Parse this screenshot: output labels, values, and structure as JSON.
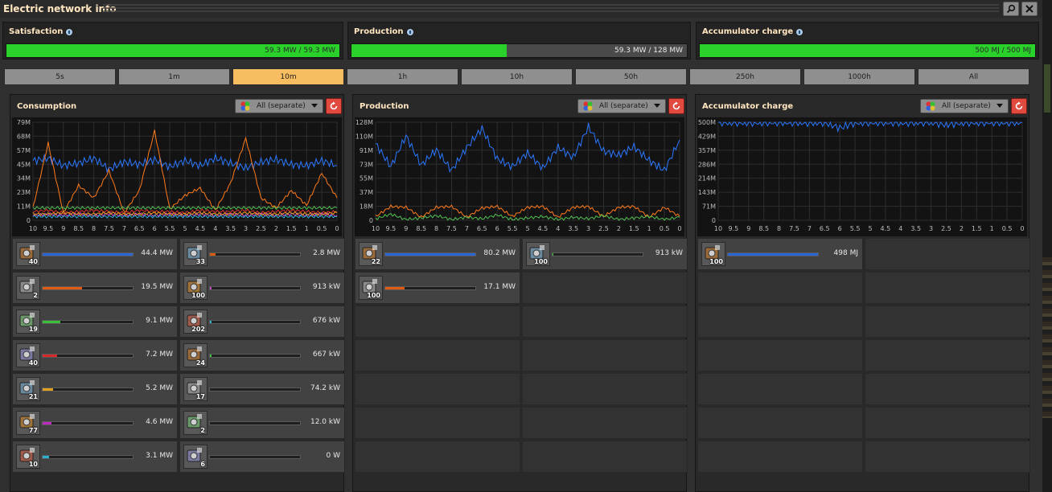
{
  "window": {
    "title": "Electric network info"
  },
  "stats": [
    {
      "label": "Satisfaction",
      "value_text": "59.3 MW / 59.3 MW",
      "fill": 1.0
    },
    {
      "label": "Production",
      "value_text": "59.3 MW / 128 MW",
      "fill": 0.463
    },
    {
      "label": "Accumulator charge",
      "value_text": "500 MJ / 500 MJ",
      "fill": 1.0
    }
  ],
  "ranges": [
    "5s",
    "1m",
    "10m",
    "1h",
    "10h",
    "50h",
    "250h",
    "1000h",
    "All"
  ],
  "selected_range": "10m",
  "panels": [
    {
      "title": "Consumption",
      "filter": "All (separate)",
      "items": [
        {
          "count": "40",
          "value": "44.4 MW",
          "fill": 1.0,
          "color": "#2a66d6"
        },
        {
          "count": "33",
          "value": "2.8 MW",
          "fill": 0.06,
          "color": "#d65a10"
        },
        {
          "count": "2",
          "value": "19.5 MW",
          "fill": 0.44,
          "color": "#e25a12"
        },
        {
          "count": "100",
          "value": "913 kW",
          "fill": 0.02,
          "color": "#c04ac0"
        },
        {
          "count": "19",
          "value": "9.1 MW",
          "fill": 0.2,
          "color": "#3cc03c"
        },
        {
          "count": "202",
          "value": "676 kW",
          "fill": 0.015,
          "color": "#2ab0d0"
        },
        {
          "count": "40",
          "value": "7.2 MW",
          "fill": 0.16,
          "color": "#d62a2a"
        },
        {
          "count": "24",
          "value": "667 kW",
          "fill": 0.015,
          "color": "#3cc03c"
        },
        {
          "count": "21",
          "value": "5.2 MW",
          "fill": 0.12,
          "color": "#e0a020"
        },
        {
          "count": "17",
          "value": "74.2 kW",
          "fill": 0.0,
          "color": "#d62a2a"
        },
        {
          "count": "77",
          "value": "4.6 MW",
          "fill": 0.1,
          "color": "#c02ac0"
        },
        {
          "count": "2",
          "value": "12.0 kW",
          "fill": 0.0,
          "color": "#c04ac0"
        },
        {
          "count": "10",
          "value": "3.1 MW",
          "fill": 0.07,
          "color": "#2ab0d0"
        },
        {
          "count": "6",
          "value": "0 W",
          "fill": 0.0,
          "color": "#888888"
        }
      ]
    },
    {
      "title": "Production",
      "filter": "All (separate)",
      "items": [
        {
          "count": "22",
          "value": "80.2 MW",
          "fill": 1.0,
          "color": "#2a66d6"
        },
        {
          "count": "100",
          "value": "913 kW",
          "fill": 0.01,
          "color": "#3cc03c"
        },
        {
          "count": "100",
          "value": "17.1 MW",
          "fill": 0.21,
          "color": "#e25a12"
        }
      ]
    },
    {
      "title": "Accumulator charge",
      "filter": "All (separate)",
      "items": [
        {
          "count": "100",
          "value": "498 MJ",
          "fill": 1.0,
          "color": "#2a66d6"
        }
      ]
    }
  ],
  "chart_data": [
    {
      "type": "line",
      "title": "Consumption",
      "x": [
        10,
        9.5,
        9,
        8.5,
        8,
        7.5,
        7,
        6.5,
        6,
        5.5,
        5,
        4.5,
        4,
        3.5,
        3,
        2.5,
        2,
        1.5,
        1,
        0.5,
        0
      ],
      "x_ticks": [
        "10",
        "9.5",
        "9",
        "8.5",
        "8",
        "7.5",
        "7",
        "6.5",
        "6",
        "5.5",
        "5",
        "4.5",
        "4",
        "3.5",
        "3",
        "2.5",
        "2",
        "1.5",
        "1",
        "0.5",
        "0"
      ],
      "y_ticks": [
        "79M",
        "68M",
        "57M",
        "45M",
        "34M",
        "23M",
        "11M",
        "0"
      ],
      "ylim": [
        0,
        79
      ],
      "series": [
        {
          "color": "#2a78ff",
          "values": [
            48,
            50,
            44,
            46,
            50,
            41,
            47,
            45,
            49,
            43,
            48,
            44,
            50,
            46,
            42,
            47,
            49,
            45,
            44,
            48,
            44
          ]
        },
        {
          "color": "#ff7a1a",
          "values": [
            10,
            62,
            6,
            28,
            18,
            40,
            6,
            24,
            72,
            9,
            20,
            26,
            8,
            30,
            66,
            18,
            10,
            24,
            12,
            38,
            18
          ]
        },
        {
          "color": "#52c052",
          "values": [
            10,
            10,
            10,
            10,
            10,
            10,
            10,
            10,
            10,
            10,
            10,
            10,
            10,
            10,
            10,
            10,
            10,
            10,
            10,
            10,
            10
          ]
        },
        {
          "color": "#e03030",
          "values": [
            7,
            8,
            6,
            7,
            8,
            7,
            6,
            8,
            7,
            7,
            6,
            8,
            7,
            7,
            8,
            6,
            7,
            8,
            7,
            6,
            7
          ]
        },
        {
          "color": "#d040d0",
          "values": [
            4,
            5,
            4,
            5,
            4,
            5,
            4,
            5,
            4,
            5,
            4,
            5,
            4,
            5,
            4,
            5,
            4,
            5,
            4,
            5,
            4
          ]
        },
        {
          "color": "#30b0d8",
          "values": [
            3,
            3,
            3,
            3,
            3,
            3,
            3,
            3,
            3,
            3,
            3,
            3,
            3,
            3,
            3,
            3,
            3,
            3,
            3,
            3,
            3
          ]
        },
        {
          "color": "#e0a020",
          "values": [
            5,
            5,
            6,
            5,
            5,
            6,
            5,
            5,
            6,
            5,
            5,
            6,
            5,
            5,
            6,
            5,
            5,
            6,
            5,
            5,
            6
          ]
        }
      ]
    },
    {
      "type": "line",
      "title": "Production",
      "x": [
        10,
        9.5,
        9,
        8.5,
        8,
        7.5,
        7,
        6.5,
        6,
        5.5,
        5,
        4.5,
        4,
        3.5,
        3,
        2.5,
        2,
        1.5,
        1,
        0.5,
        0
      ],
      "x_ticks": [
        "10",
        "9.5",
        "9",
        "8.5",
        "8",
        "7.5",
        "7",
        "6.5",
        "6",
        "5.5",
        "5",
        "4.5",
        "4",
        "3.5",
        "3",
        "2.5",
        "2",
        "1.5",
        "1",
        "0.5",
        "0"
      ],
      "y_ticks": [
        "128M",
        "110M",
        "91M",
        "73M",
        "55M",
        "37M",
        "18M",
        "0"
      ],
      "ylim": [
        0,
        128
      ],
      "series": [
        {
          "color": "#2a78ff",
          "values": [
            100,
            70,
            110,
            72,
            92,
            65,
            95,
            120,
            80,
            70,
            88,
            68,
            95,
            82,
            122,
            90,
            85,
            96,
            78,
            65,
            105
          ]
        },
        {
          "color": "#ff7a1a",
          "values": [
            5,
            18,
            17,
            4,
            17,
            18,
            4,
            16,
            18,
            5,
            17,
            18,
            4,
            17,
            18,
            5,
            17,
            18,
            4,
            17,
            5
          ]
        },
        {
          "color": "#52c052",
          "values": [
            2,
            8,
            1,
            3,
            6,
            1,
            4,
            2,
            7,
            1,
            3,
            5,
            1,
            4,
            2,
            6,
            1,
            3,
            5,
            1,
            4
          ]
        }
      ]
    },
    {
      "type": "line",
      "title": "Accumulator charge",
      "x": [
        10,
        9.5,
        9,
        8.5,
        8,
        7.5,
        7,
        6.5,
        6,
        5.5,
        5,
        4.5,
        4,
        3.5,
        3,
        2.5,
        2,
        1.5,
        1,
        0.5,
        0
      ],
      "x_ticks": [
        "10",
        "9.5",
        "9",
        "8.5",
        "8",
        "7.5",
        "7",
        "6.5",
        "6",
        "5.5",
        "5",
        "4.5",
        "4",
        "3.5",
        "3",
        "2.5",
        "2",
        "1.5",
        "1",
        "0.5",
        "0"
      ],
      "y_ticks": [
        "500M",
        "429M",
        "357M",
        "286M",
        "214M",
        "143M",
        "71M",
        "0"
      ],
      "ylim": [
        0,
        500
      ],
      "series": [
        {
          "color": "#2a78ff",
          "values": [
            500,
            499,
            498,
            499,
            500,
            499,
            497,
            499,
            470,
            498,
            499,
            500,
            497,
            499,
            500,
            487,
            498,
            499,
            500,
            499,
            500
          ]
        }
      ]
    }
  ]
}
